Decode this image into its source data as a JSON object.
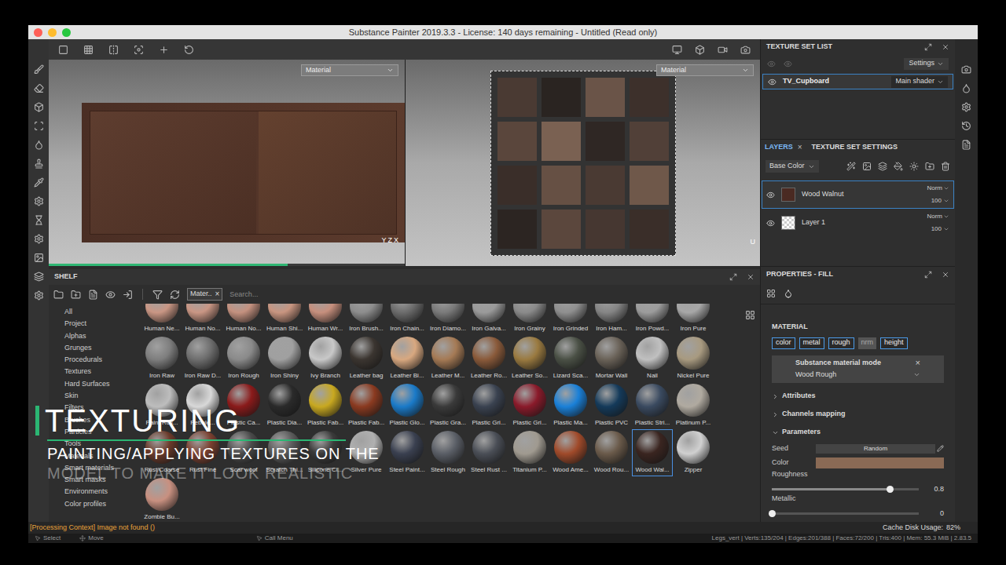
{
  "window": {
    "title": "Substance Painter 2019.3.3 - License: 140 days remaining - Untitled (Read only)"
  },
  "viewports": [
    {
      "name": "3d",
      "dropdown": "Material",
      "axes": [
        "Y",
        "Z",
        "X"
      ]
    },
    {
      "name": "2d",
      "dropdown": "Material",
      "axes": [
        "U"
      ]
    }
  ],
  "progress": {
    "level": 0.67
  },
  "shelf": {
    "title": "SHELF",
    "filter_chip": "Mater..",
    "filter_chip_close": "×",
    "search_placeholder": "Search...",
    "categories": [
      "All",
      "Project",
      "Alphas",
      "Grunges",
      "Procedurals",
      "Textures",
      "Hard Surfaces",
      "Skin",
      "Filters",
      "Brushes",
      "Particles",
      "Tools",
      "Materials",
      "Smart materials",
      "Smart masks",
      "Environments",
      "Color profiles"
    ],
    "materials": [
      {
        "label": "Human Ne...",
        "color": "#c99684",
        "selected": false
      },
      {
        "label": "Human No...",
        "color": "#c99684",
        "selected": false
      },
      {
        "label": "Human No...",
        "color": "#c4917f",
        "selected": false
      },
      {
        "label": "Human Shi...",
        "color": "#c89580",
        "selected": false
      },
      {
        "label": "Human Wr...",
        "color": "#c68f7d",
        "selected": false
      },
      {
        "label": "Iron Brush...",
        "color": "#8d8d8d",
        "selected": false
      },
      {
        "label": "Iron Chain...",
        "color": "#6c6c6c",
        "selected": false
      },
      {
        "label": "Iron Diamo...",
        "color": "#7a7a7a",
        "selected": false
      },
      {
        "label": "Iron Galva...",
        "color": "#9a9a9a",
        "selected": false
      },
      {
        "label": "Iron Grainy",
        "color": "#8a8a8a",
        "selected": false
      },
      {
        "label": "Iron Grinded",
        "color": "#8f8f8f",
        "selected": false
      },
      {
        "label": "Iron Ham...",
        "color": "#858585",
        "selected": false
      },
      {
        "label": "Iron Powd...",
        "color": "#9c9c9c",
        "selected": false
      },
      {
        "label": "Iron Pure",
        "color": "#a7a7a7",
        "selected": false
      },
      {
        "label": "Iron Raw",
        "color": "#7e7e7e",
        "selected": false
      },
      {
        "label": "Iron Raw D...",
        "color": "#6e6e6e",
        "selected": false
      },
      {
        "label": "Iron Rough",
        "color": "#8a8a8a",
        "selected": false
      },
      {
        "label": "Iron Shiny",
        "color": "#a0a0a0",
        "selected": false
      },
      {
        "label": "Ivy Branch",
        "color": "#c8c8c8",
        "selected": false
      },
      {
        "label": "Leather bag",
        "color": "#3b3530",
        "selected": false
      },
      {
        "label": "Leather Bi...",
        "color": "#d8a880",
        "selected": false
      },
      {
        "label": "Leather M...",
        "color": "#a57a55",
        "selected": false
      },
      {
        "label": "Leather Ro...",
        "color": "#8a5a3a",
        "selected": false
      },
      {
        "label": "Leather So...",
        "color": "#9a7a40",
        "selected": false
      },
      {
        "label": "Lizard Sca...",
        "color": "#4a5045",
        "selected": false
      },
      {
        "label": "Mortar Wall",
        "color": "#6a6258",
        "selected": false
      },
      {
        "label": "Nail",
        "color": "#c0c0c0",
        "selected": false
      },
      {
        "label": "Nickel Pure",
        "color": "#a89a80",
        "selected": false
      },
      {
        "label": "Paint Roll...",
        "color": "#bdbdbd",
        "selected": false
      },
      {
        "label": "Pebble...",
        "color": "#d8d8d8",
        "selected": false
      },
      {
        "label": "Plastic Ca...",
        "color": "#8a1a1a",
        "selected": false
      },
      {
        "label": "Plastic Dia...",
        "color": "#2a2a2a",
        "selected": false
      },
      {
        "label": "Plastic Fab...",
        "color": "#c8a820",
        "selected": false
      },
      {
        "label": "Plastic Fab...",
        "color": "#8a3a20",
        "selected": false
      },
      {
        "label": "Plastic Glo...",
        "color": "#1a7ac8",
        "selected": false
      },
      {
        "label": "Plastic Gra...",
        "color": "#3a3a3a",
        "selected": false
      },
      {
        "label": "Plastic Gri...",
        "color": "#3a4250",
        "selected": false
      },
      {
        "label": "Plastic Gri...",
        "color": "#8a1a2a",
        "selected": false
      },
      {
        "label": "Plastic Ma...",
        "color": "#1a80d8",
        "selected": false
      },
      {
        "label": "Plastic PVC",
        "color": "#143a5a",
        "selected": false
      },
      {
        "label": "Plastic Stri...",
        "color": "#3a4a60",
        "selected": false
      },
      {
        "label": "Platinum P...",
        "color": "#b0aaa0",
        "selected": false
      },
      {
        "label": "Rust Coarse",
        "color": "#6a3a2a",
        "selected": false
      },
      {
        "label": "Rust Fine",
        "color": "#7a4030",
        "selected": false
      },
      {
        "label": "Scar wool",
        "color": "#4a4a4a",
        "selected": false
      },
      {
        "label": "Scratch Thi...",
        "color": "#5a5a5a",
        "selected": false
      },
      {
        "label": "Silicone Cl...",
        "color": "#3a3a3a",
        "selected": false
      },
      {
        "label": "Silver Pure",
        "color": "#b0b0b0",
        "selected": false
      },
      {
        "label": "Steel Paint...",
        "color": "#3a4050",
        "selected": false
      },
      {
        "label": "Steel Rough",
        "color": "#5a5e66",
        "selected": false
      },
      {
        "label": "Steel Rust ...",
        "color": "#4a4e56",
        "selected": false
      },
      {
        "label": "Titanium P...",
        "color": "#a09a90",
        "selected": false
      },
      {
        "label": "Wood Ame...",
        "color": "#a04a2a",
        "selected": false
      },
      {
        "label": "Wood Rou...",
        "color": "#6a5a4a",
        "selected": false
      },
      {
        "label": "Wood Wal...",
        "color": "#3a2520",
        "selected": true
      },
      {
        "label": "Zipper",
        "color": "#d0d0d0",
        "selected": false
      },
      {
        "label": "Zombie Bu...",
        "color": "#c89080",
        "selected": false
      }
    ]
  },
  "texture_set_list": {
    "title": "TEXTURE SET LIST",
    "settings": "Settings",
    "items": [
      {
        "name": "TV_Cupboard",
        "shader": "Main shader",
        "selected": true
      }
    ]
  },
  "layers": {
    "tabs": [
      {
        "label": "LAYERS",
        "selected": true
      },
      {
        "label": "TEXTURE SET SETTINGS",
        "selected": false
      }
    ],
    "close": "×",
    "channel": "Base Color",
    "items": [
      {
        "name": "Wood Walnut",
        "blend": "Norm",
        "opacity": "100",
        "selected": true,
        "visible": true,
        "kind": "fill"
      },
      {
        "name": "Layer 1",
        "blend": "Norm",
        "opacity": "100",
        "selected": false,
        "visible": true,
        "kind": "paint"
      }
    ]
  },
  "properties": {
    "title": "PROPERTIES - FILL",
    "section": "MATERIAL",
    "channels": [
      {
        "label": "color",
        "active": true
      },
      {
        "label": "metal",
        "active": true
      },
      {
        "label": "rough",
        "active": true
      },
      {
        "label": "nrm",
        "active": false
      },
      {
        "label": "height",
        "active": true
      }
    ],
    "mode": {
      "label": "Substance material mode",
      "value": "Wood Rough",
      "close": "×"
    },
    "groups": [
      {
        "label": "Attributes",
        "expanded": false
      },
      {
        "label": "Channels mapping",
        "expanded": false
      },
      {
        "label": "Parameters",
        "expanded": true
      }
    ],
    "params": [
      {
        "kind": "button",
        "label": "Seed",
        "value": "Random"
      },
      {
        "kind": "color",
        "label": "Color",
        "color": "#8a6a55"
      },
      {
        "kind": "slider",
        "label": "Roughness",
        "level": 0.8,
        "reading": "0.8"
      },
      {
        "kind": "slider",
        "label": "Metallic",
        "level": 0,
        "reading": "0"
      }
    ]
  },
  "status_bar": {
    "message": "[Processing Context] Image not found ()",
    "cache": "Cache Disk Usage:",
    "cache_value": "82%"
  },
  "bottom_bar": {
    "items": [
      "Select",
      "Move",
      "Call Menu"
    ],
    "stats": "Legs_vert | Verts:135/204 | Edges:201/388 | Faces:72/200 | Tris:400 | Mem: 55.3 MiB | 2.83.5"
  },
  "overlay": {
    "title": "TEXTURING",
    "lines": [
      "PAINTING/APPLYING TEXTURES ON THE",
      "MODEL TO MAKE IT LOOK REALISTIC"
    ]
  }
}
